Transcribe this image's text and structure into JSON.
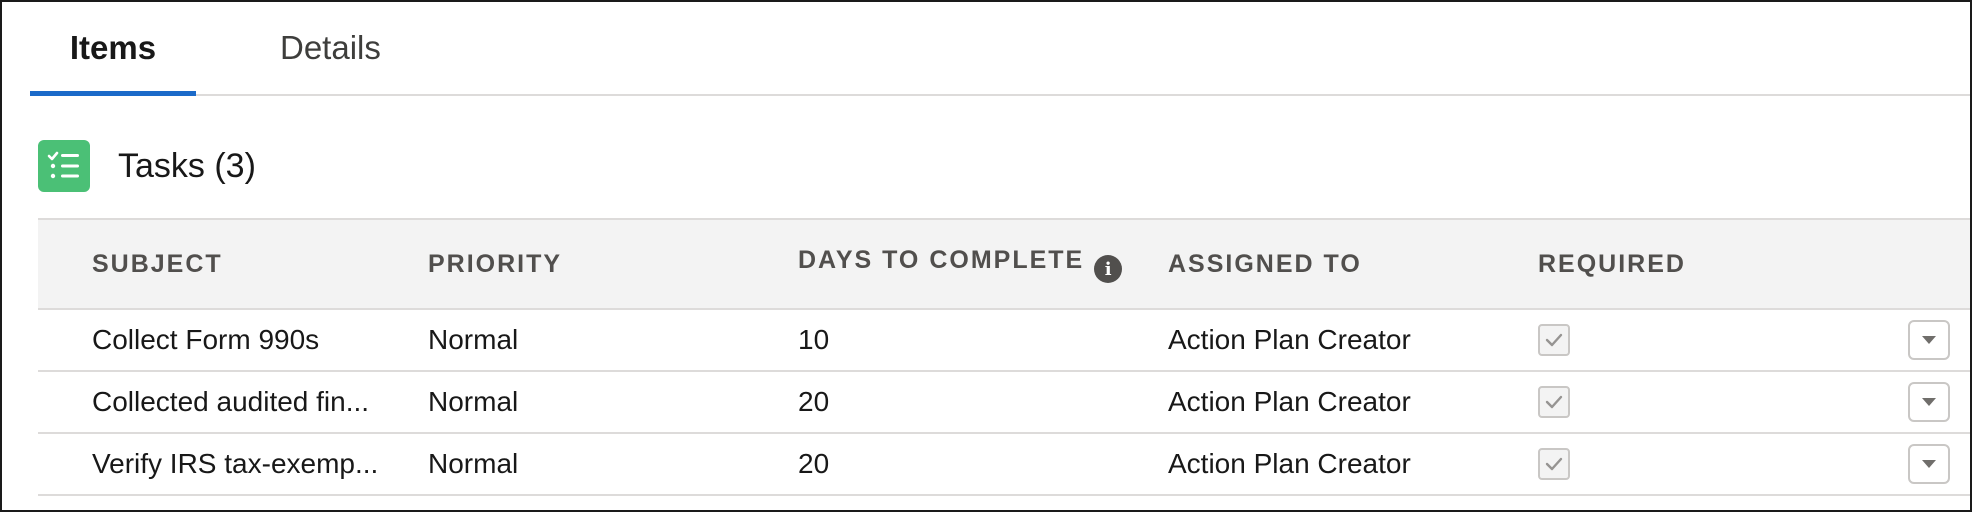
{
  "tabs": [
    {
      "label": "Items",
      "active": true
    },
    {
      "label": "Details",
      "active": false
    }
  ],
  "section": {
    "title": "Tasks (3)",
    "icon": "task-list-icon",
    "icon_color": "#4bc076"
  },
  "table": {
    "columns": [
      "SUBJECT",
      "PRIORITY",
      "DAYS TO COMPLETE",
      "ASSIGNED TO",
      "REQUIRED"
    ],
    "rows": [
      {
        "subject": "Collect Form 990s",
        "priority": "Normal",
        "days": "10",
        "assigned_to": "Action Plan Creator",
        "required": true
      },
      {
        "subject": "Collected audited fin...",
        "priority": "Normal",
        "days": "20",
        "assigned_to": "Action Plan Creator",
        "required": true
      },
      {
        "subject": "Verify IRS tax-exemp...",
        "priority": "Normal",
        "days": "20",
        "assigned_to": "Action Plan Creator",
        "required": true
      }
    ]
  },
  "colors": {
    "accent": "#1b6ac9",
    "header_bg": "#f3f3f3",
    "border": "#dddbda"
  }
}
